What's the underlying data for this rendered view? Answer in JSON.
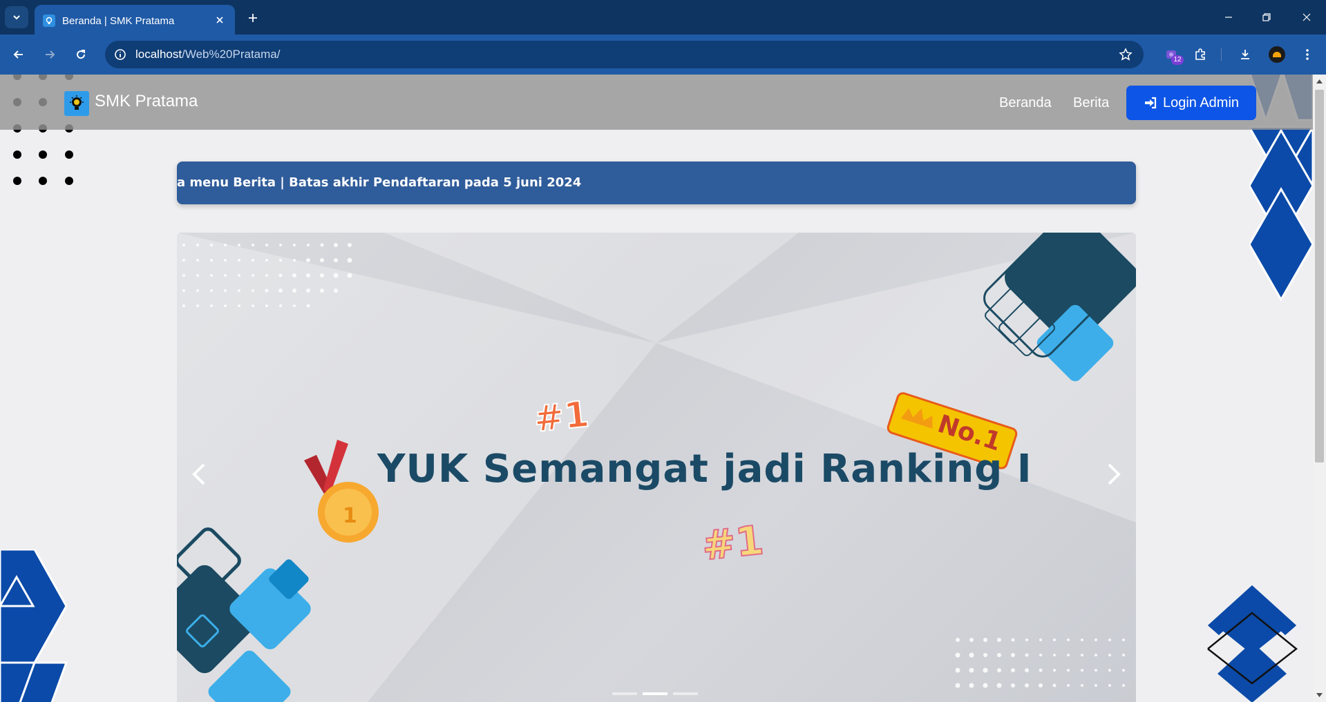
{
  "browser": {
    "tab": {
      "title": "Beranda | SMK Pratama"
    },
    "url": {
      "host": "localhost",
      "path": "/Web%20Pratama/"
    },
    "extension_badge": "12"
  },
  "site": {
    "brand": "SMK Pratama",
    "nav": [
      {
        "label": "Beranda"
      },
      {
        "label": "Berita"
      }
    ],
    "login_label": "Login Admin"
  },
  "marquee": {
    "text": "a menu Berita | Batas akhir Pendaftaran pada 5 juni 2024"
  },
  "carousel": {
    "slide_title": "YUK Semangat jadi Ranking I",
    "sticker_hash_1": "#1",
    "sticker_hash_2": "#1",
    "badge_no1": "No.1",
    "medal_number": "1",
    "slide_count": 3,
    "active_slide": 2
  },
  "colors": {
    "chrome_dark": "#0e3461",
    "chrome_toolbar": "#1f5aa6",
    "marquee_bg": "#2f5c9a",
    "login_btn": "#0d55e6",
    "slide_title": "#1b4a66",
    "deco_blue": "#0b4aa8"
  }
}
